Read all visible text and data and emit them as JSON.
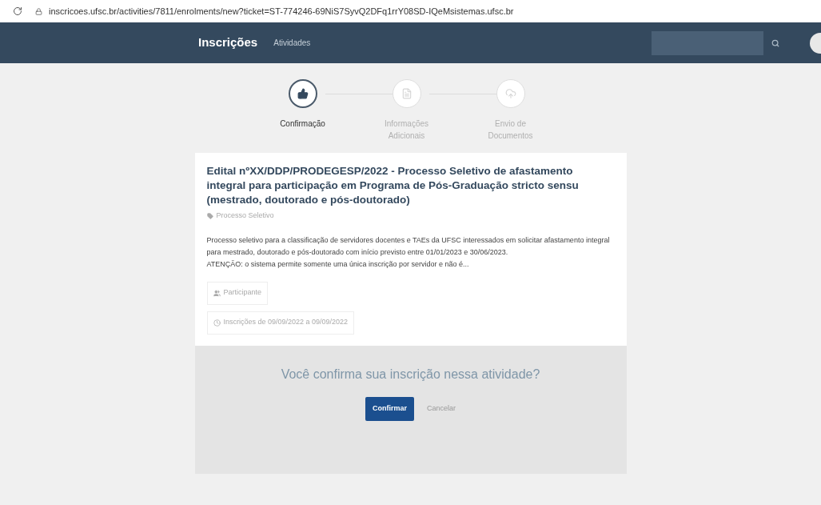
{
  "browser": {
    "url": "inscricoes.ufsc.br/activities/7811/enrolments/new?ticket=ST-774246-69NiS7SyvQ2DFq1rrY08SD-IQeMsistemas.ufsc.br"
  },
  "navbar": {
    "brand": "Inscrições",
    "links": [
      "Atividades"
    ]
  },
  "steps": [
    {
      "label": "Confirmação",
      "selected": true,
      "kind": "thumb"
    },
    {
      "label": "Informações Adicionais",
      "selected": false,
      "kind": "file"
    },
    {
      "label": "Envio de Documentos",
      "selected": false,
      "kind": "cloud"
    }
  ],
  "card": {
    "title": "Edital nºXX/DDP/PRODEGESP/2022 - Processo Seletivo de afastamento integral para participação em Programa de Pós-Graduação stricto sensu (mestrado, doutorado e pós-doutorado)",
    "category": "Processo Seletivo",
    "description": [
      "Processo seletivo para a classificação de servidores docentes e TAEs da UFSC interessados em solicitar afastamento integral para mestrado, doutorado e pós-doutorado com início previsto entre 01/01/2023 e 30/06/2023.",
      "ATENÇÃO: o sistema permite somente uma única inscrição por servidor e não é..."
    ],
    "role": "Participante",
    "period": "Inscrições de 09/09/2022 a 09/09/2022"
  },
  "confirm": {
    "question": "Você confirma sua inscrição nessa atividade?",
    "confirm_button": "Confirmar",
    "cancel_link": "Cancelar"
  }
}
